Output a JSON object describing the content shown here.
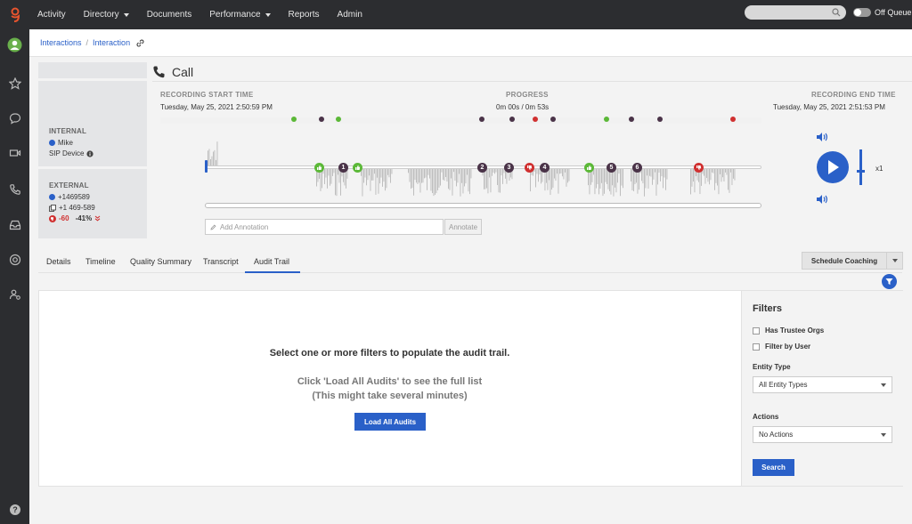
{
  "nav": {
    "items": [
      "Activity",
      "Directory",
      "Documents",
      "Performance",
      "Reports",
      "Admin"
    ],
    "queue_label": "Off Queue",
    "search_placeholder": ""
  },
  "breadcrumb": {
    "interactions": "Interactions",
    "separator": "/",
    "interaction": "Interaction"
  },
  "call": {
    "title": "Call"
  },
  "participants": {
    "internal": {
      "title": "INTERNAL",
      "name": "Mike",
      "device": "SIP Device"
    },
    "external": {
      "title": "EXTERNAL",
      "number": "+1469589",
      "alt_number": "+1 469-589",
      "sentiment": "-60",
      "trend": "-41%"
    }
  },
  "recording": {
    "start_label": "RECORDING START TIME",
    "start_value": "Tuesday, May 25, 2021 2:50:59 PM",
    "progress_label": "PROGRESS",
    "progress_value": "0m 00s / 0m 53s",
    "end_label": "RECORDING END TIME",
    "end_value": "Tuesday, May 25, 2021 2:51:53 PM",
    "speed": "x1"
  },
  "annotation": {
    "placeholder": "Add Annotation",
    "button": "Annotate"
  },
  "markers": {
    "bubbles": [
      "1",
      "2",
      "3",
      "4",
      "5",
      "6"
    ]
  },
  "tabs": [
    "Details",
    "Timeline",
    "Quality Summary",
    "Transcript",
    "Audit Trail"
  ],
  "active_tab": "Audit Trail",
  "coaching": {
    "button": "Schedule Coaching"
  },
  "audit": {
    "message": "Select one or more filters to populate the audit trail.",
    "hint_line1": "Click 'Load All Audits' to see the full list",
    "hint_line2": "(This might take several minutes)",
    "load_button": "Load All Audits"
  },
  "filters": {
    "title": "Filters",
    "trustee": "Has Trustee Orgs",
    "by_user": "Filter by User",
    "entity_label": "Entity Type",
    "entity_value": "All Entity Types",
    "actions_label": "Actions",
    "actions_value": "No Actions",
    "search_button": "Search"
  },
  "colors": {
    "accent": "#2a60c8",
    "nav_bg": "#2c2d30",
    "positive": "#5bb837",
    "negative": "#d03030",
    "neutral_marker": "#4a3348"
  }
}
